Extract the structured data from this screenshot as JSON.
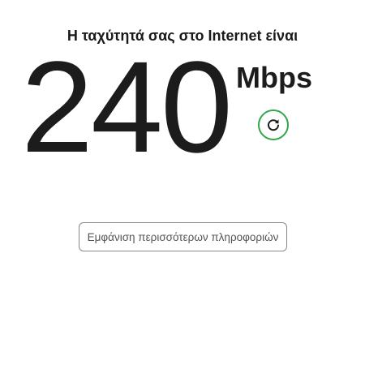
{
  "header": {
    "title": "Η ταχύτητά σας στο Internet είναι"
  },
  "result": {
    "speed_value": "240",
    "speed_unit": "Mbps"
  },
  "actions": {
    "refresh_icon": "refresh-icon",
    "more_info_label": "Εμφάνιση περισσότερων πληροφοριών"
  },
  "colors": {
    "accent": "#2ea84a",
    "text": "#1c1c1c",
    "button_border": "#8a8a8a"
  }
}
